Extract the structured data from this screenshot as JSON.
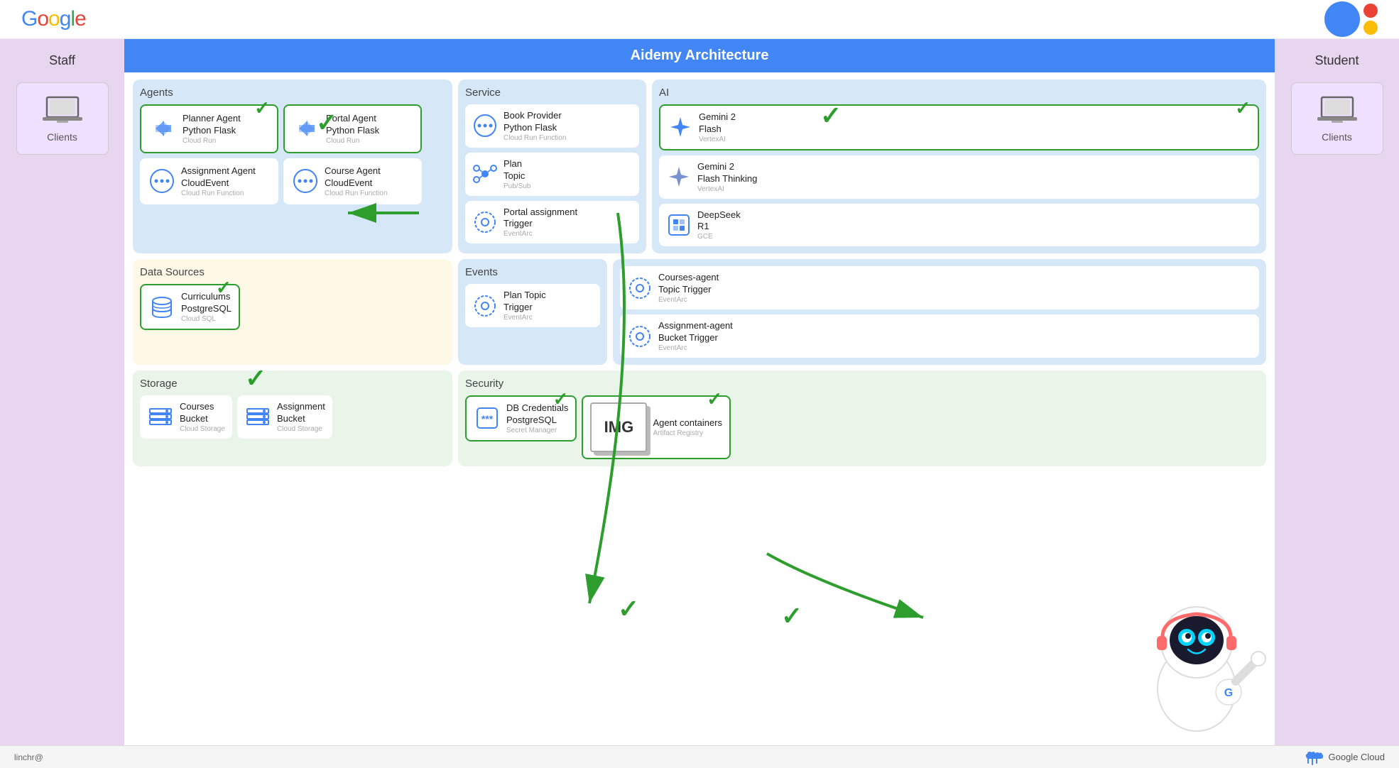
{
  "page": {
    "title": "Aidemy Architecture",
    "google_logo": "Google",
    "bottom_user": "linchr@",
    "google_cloud_label": "Google Cloud"
  },
  "staff": {
    "label": "Staff",
    "client_label": "Clients"
  },
  "student": {
    "label": "Student",
    "client_label": "Clients"
  },
  "agents": {
    "panel_label": "Agents",
    "cards": [
      {
        "title": "Planner Agent\nPython Flask",
        "subtitle": "Cloud Run",
        "highlighted": true,
        "checkmark": true
      },
      {
        "title": "Portal Agent\nPython Flask",
        "subtitle": "Cloud Run",
        "highlighted": true,
        "checkmark": false
      },
      {
        "title": "Assignment Agent\nCloudEvent",
        "subtitle": "Cloud Run Function",
        "highlighted": false
      },
      {
        "title": "Course Agent\nCloudEvent",
        "subtitle": "Cloud Run Function",
        "highlighted": false
      }
    ]
  },
  "service": {
    "panel_label": "Service",
    "cards": [
      {
        "title": "Book Provider\nPython Flask",
        "subtitle": "Cloud Run Function",
        "highlighted": false
      },
      {
        "title": "Plan\nTopic",
        "subtitle": "Pub/Sub",
        "highlighted": false
      },
      {
        "title": "Portal assignment\nTrigger",
        "subtitle": "EventArc",
        "highlighted": false
      }
    ]
  },
  "ai": {
    "panel_label": "AI",
    "cards": [
      {
        "title": "Gemini 2\nFlash",
        "subtitle": "VertexAI",
        "highlighted": true,
        "checkmark": true
      },
      {
        "title": "Gemini 2\nFlash Thinking",
        "subtitle": "VertexAI",
        "highlighted": false
      },
      {
        "title": "DeepSeek\nR1",
        "subtitle": "GCE",
        "highlighted": false
      }
    ]
  },
  "datasources": {
    "panel_label": "Data Sources",
    "cards": [
      {
        "title": "Curriculums\nPostgreSQL",
        "subtitle": "Cloud SQL",
        "highlighted": true,
        "checkmark": true
      }
    ]
  },
  "events": {
    "panel_label": "Events",
    "cards": [
      {
        "title": "Plan Topic\nTrigger",
        "subtitle": "EventArc",
        "highlighted": false
      }
    ]
  },
  "triggers": {
    "cards": [
      {
        "title": "Courses-agent\nTopic Trigger",
        "subtitle": "EventArc",
        "highlighted": false
      },
      {
        "title": "Assignment-agent\nBucket Trigger",
        "subtitle": "EventArc",
        "highlighted": false
      }
    ]
  },
  "storage": {
    "panel_label": "Storage",
    "cards": [
      {
        "title": "Courses\nBucket",
        "subtitle": "Cloud Storage",
        "highlighted": false
      },
      {
        "title": "Assignment\nBucket",
        "subtitle": "Cloud Storage",
        "highlighted": false
      }
    ]
  },
  "security": {
    "panel_label": "Security",
    "cards": [
      {
        "title": "DB Credentials\nPostgreSQL",
        "subtitle": "Secret Manager",
        "highlighted": true,
        "checkmark": true
      },
      {
        "title": "Agent containers",
        "subtitle": "Artifact Registry",
        "highlighted": true,
        "checkmark": true,
        "img": true
      }
    ]
  }
}
